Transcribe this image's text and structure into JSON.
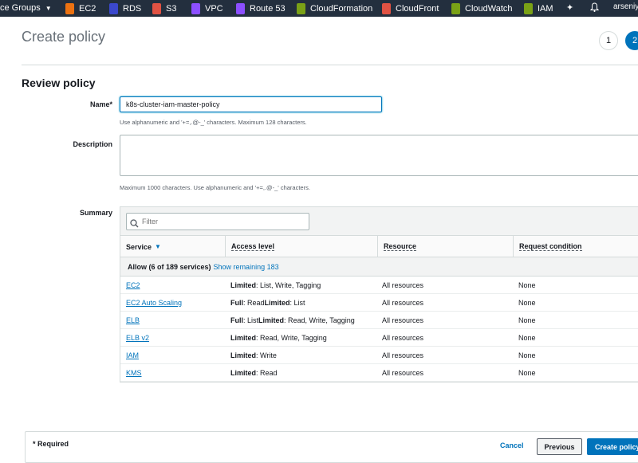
{
  "nav": {
    "resource_groups": "ce Groups",
    "services": [
      {
        "label": "EC2",
        "icon": "ec2-icon",
        "color": "#ec7211"
      },
      {
        "label": "RDS",
        "icon": "rds-icon",
        "color": "#3b48cc"
      },
      {
        "label": "S3",
        "icon": "s3-icon",
        "color": "#e05243"
      },
      {
        "label": "VPC",
        "icon": "vpc-icon",
        "color": "#8c4fff"
      },
      {
        "label": "Route 53",
        "icon": "route53-icon",
        "color": "#8c4fff"
      },
      {
        "label": "CloudFormation",
        "icon": "cloudformation-icon",
        "color": "#7aa116"
      },
      {
        "label": "CloudFront",
        "icon": "cloudfront-icon",
        "color": "#e05243"
      },
      {
        "label": "CloudWatch",
        "icon": "cloudwatch-icon",
        "color": "#7aa116"
      },
      {
        "label": "IAM",
        "icon": "iam-icon",
        "color": "#7aa116"
      }
    ],
    "user": "arseniy.z"
  },
  "header": {
    "title": "Create policy",
    "step1": "1",
    "step2": "2"
  },
  "form": {
    "section_title": "Review policy",
    "name_label": "Name*",
    "name_value": "k8s-cluster-iam-master-policy",
    "name_hint": "Use alphanumeric and '+=,.@-_' characters. Maximum 128 characters.",
    "description_label": "Description",
    "description_value": "",
    "description_hint": "Maximum 1000 characters. Use alphanumeric and '+=,.@-_' characters.",
    "summary_label": "Summary"
  },
  "summary": {
    "filter_placeholder": "Filter",
    "columns": [
      "Service",
      "Access level",
      "Resource",
      "Request condition"
    ],
    "group_bold": "Allow (6 of 189 services)",
    "group_link": "Show remaining 183",
    "rows": [
      {
        "service": "EC2",
        "access_bold": "Limited",
        "access_rest": ": List, Write, Tagging",
        "resource": "All resources",
        "condition": "None"
      },
      {
        "service": "EC2 Auto Scaling",
        "access_bold": "Full",
        "access_rest": ": Read ",
        "access_bold2": "Limited",
        "access_rest2": ": List",
        "resource": "All resources",
        "condition": "None"
      },
      {
        "service": "ELB",
        "access_bold": "Full",
        "access_rest": ": List ",
        "access_bold2": "Limited",
        "access_rest2": ": Read, Write, Tagging",
        "resource": "All resources",
        "condition": "None"
      },
      {
        "service": "ELB v2",
        "access_bold": "Limited",
        "access_rest": ": Read, Write, Tagging",
        "resource": "All resources",
        "condition": "None"
      },
      {
        "service": "IAM",
        "access_bold": "Limited",
        "access_rest": ": Write",
        "resource": "All resources",
        "condition": "None"
      },
      {
        "service": "KMS",
        "access_bold": "Limited",
        "access_rest": ": Read",
        "resource": "All resources",
        "condition": "None"
      }
    ]
  },
  "footer": {
    "required": "* Required",
    "cancel": "Cancel",
    "previous": "Previous",
    "create": "Create policy"
  }
}
